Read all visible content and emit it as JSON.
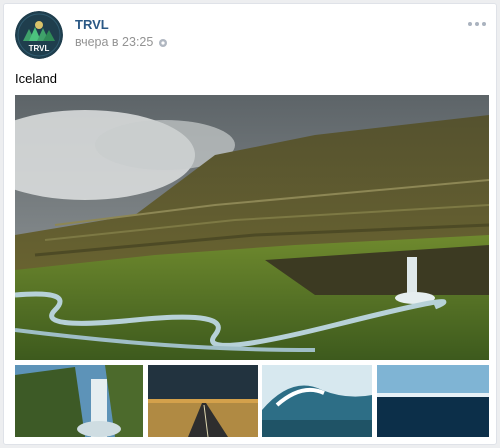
{
  "post": {
    "author": "TRVL",
    "avatar_text": "TRVL",
    "time": "вчера в 23:25",
    "text": "Iceland"
  },
  "icons": {
    "settings": "gear-icon",
    "more": "more-dots-icon"
  },
  "colors": {
    "author_link": "#2a5885",
    "meta_text": "#939393",
    "avatar_bg": "#1f3e4d",
    "background": "#edeef0"
  },
  "attachments": [
    {
      "name": "main-photo",
      "subject": "mountain waterfall landscape"
    },
    {
      "name": "thumb-waterfall",
      "subject": "waterfall"
    },
    {
      "name": "thumb-road",
      "subject": "road under storm sky"
    },
    {
      "name": "thumb-wave",
      "subject": "ocean wave"
    },
    {
      "name": "thumb-sea",
      "subject": "sea horizon"
    }
  ]
}
